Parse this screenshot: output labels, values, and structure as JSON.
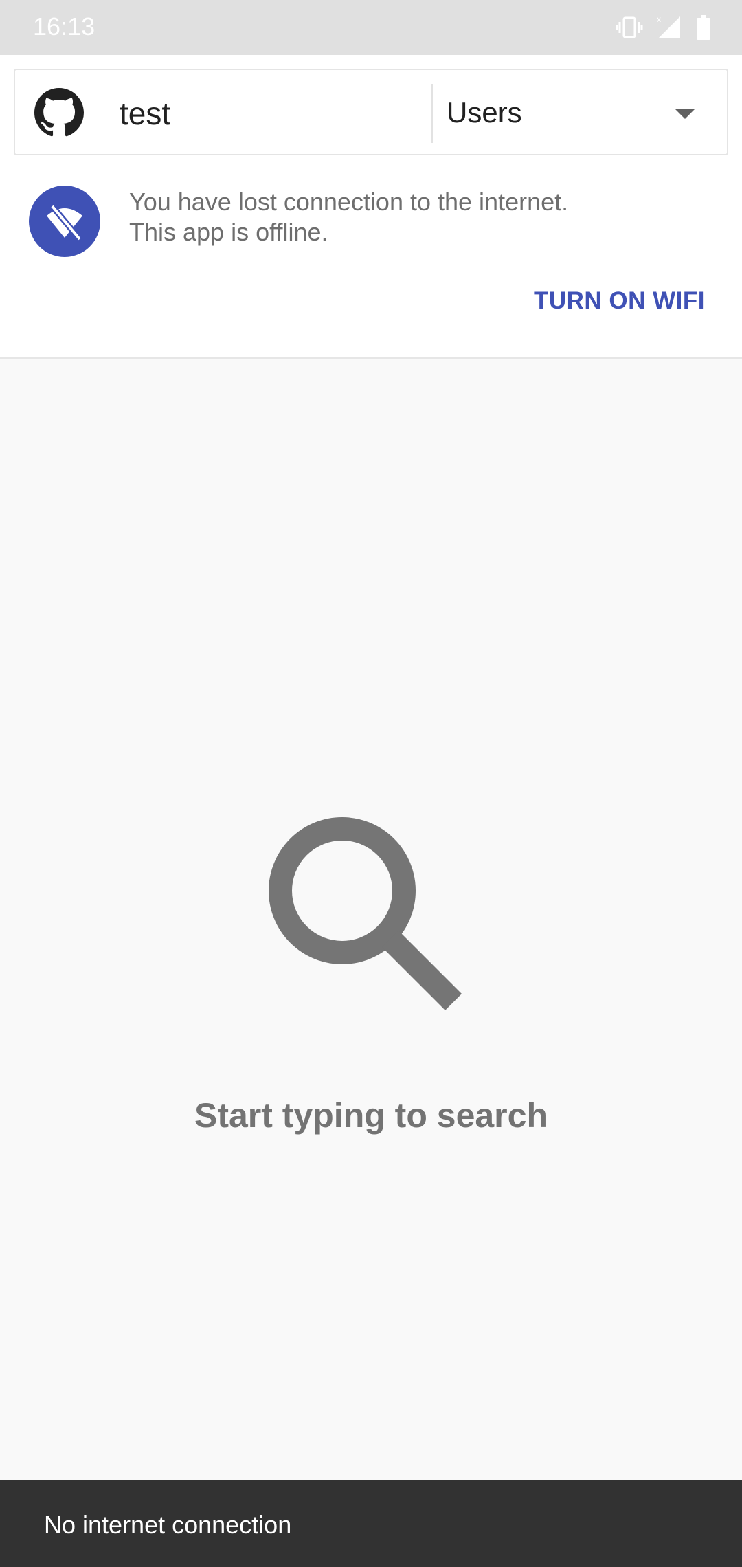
{
  "status_bar": {
    "time": "16:13",
    "icons": [
      "vibrate-icon",
      "no-signal-icon",
      "battery-icon"
    ]
  },
  "search": {
    "query": "test",
    "type_selected": "Users"
  },
  "offline_banner": {
    "message_line1": "You have lost connection to the internet.",
    "message_line2": "This app is offline.",
    "action_label": "TURN ON WIFI",
    "icon": "wifi-off-icon",
    "accent_color": "#3f51b5"
  },
  "empty_state": {
    "icon": "search-icon",
    "text": "Start typing to search"
  },
  "snackbar": {
    "text": "No internet connection"
  }
}
